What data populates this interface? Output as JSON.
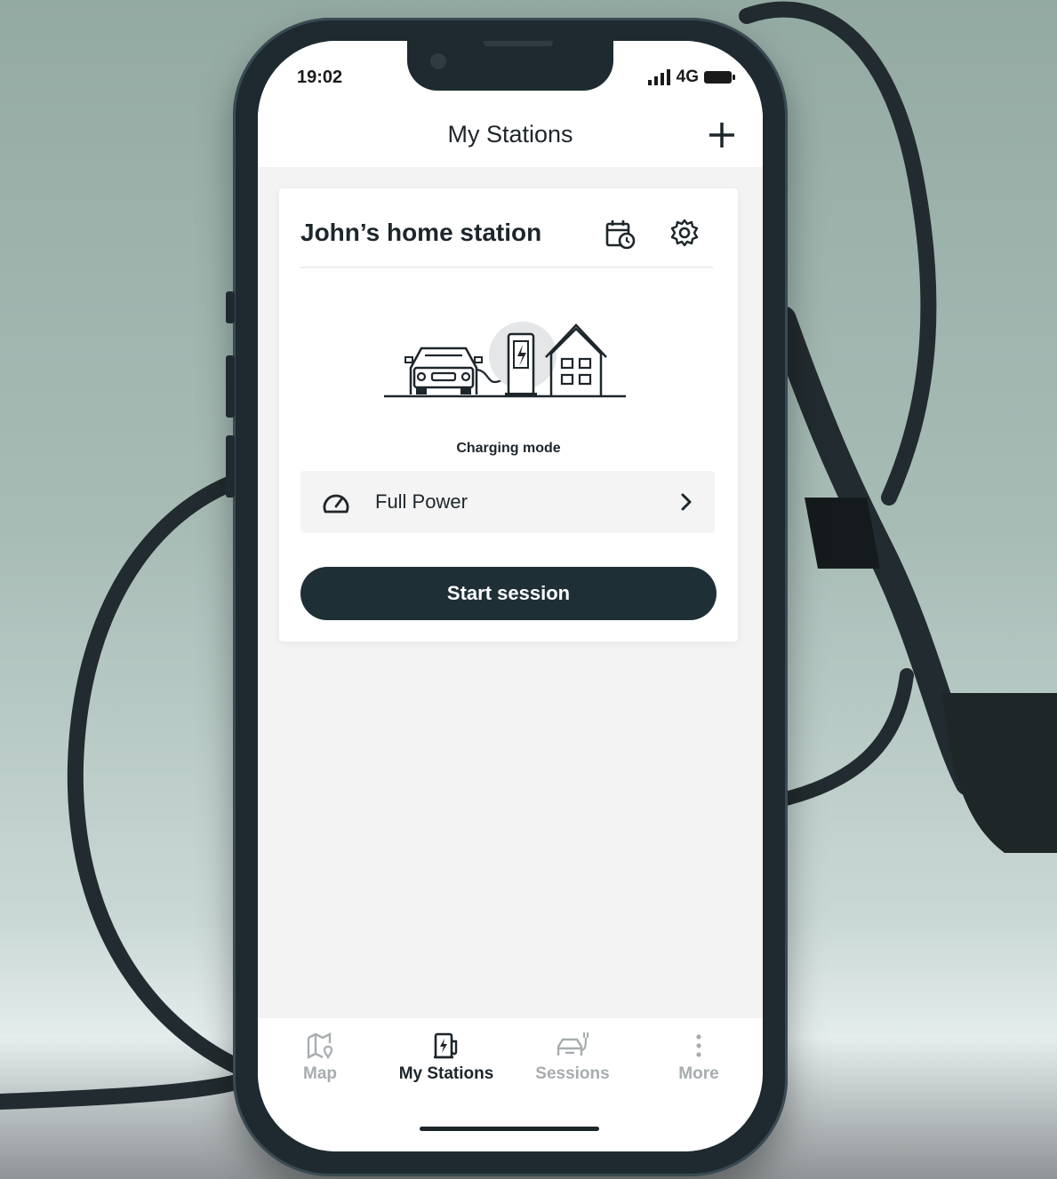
{
  "status_bar": {
    "time": "19:02",
    "network": "4G"
  },
  "header": {
    "title": "My Stations"
  },
  "station": {
    "name": "John’s home station",
    "charging_mode_label": "Charging mode",
    "charging_mode": "Full Power",
    "start_label": "Start session"
  },
  "tabs": [
    {
      "label": "Map",
      "active": false
    },
    {
      "label": "My Stations",
      "active": true
    },
    {
      "label": "Sessions",
      "active": false
    },
    {
      "label": "More",
      "active": false
    }
  ],
  "icons": {
    "header_action": "plus-icon",
    "schedule": "calendar-clock-icon",
    "settings": "gear-icon",
    "mode": "speedometer-icon",
    "tab_map": "map-pin-icon",
    "tab_stations": "charging-station-icon",
    "tab_sessions": "car-plug-icon",
    "tab_more": "more-vertical-icon"
  },
  "colors": {
    "primary": "#1f2f36",
    "inactive_tab": "#a7adaf",
    "background": "#f3f3f3"
  }
}
